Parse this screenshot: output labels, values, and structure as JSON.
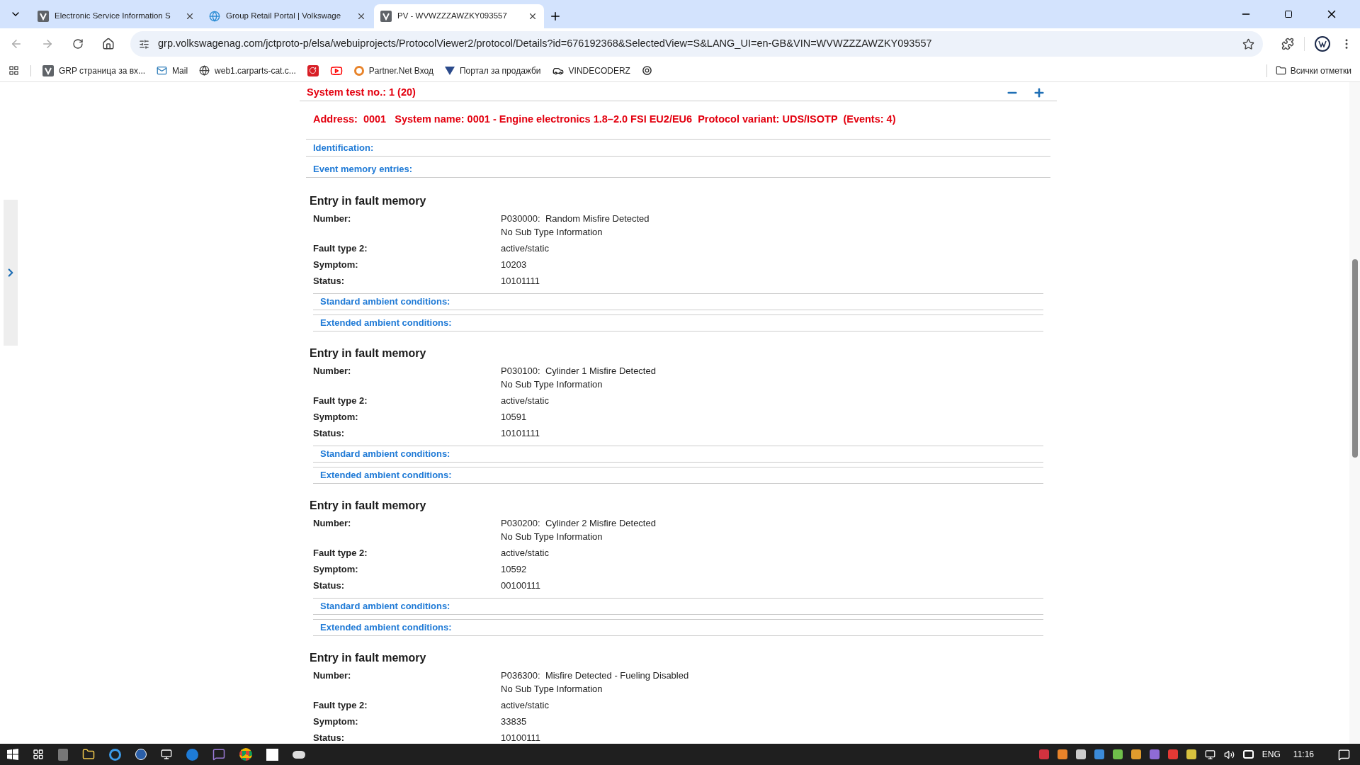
{
  "tabs": [
    {
      "title": "Electronic Service Information S",
      "selected": false
    },
    {
      "title": "Group Retail Portal | Volkswage",
      "selected": false
    },
    {
      "title": "PV - WVWZZZAWZKY093557",
      "selected": true
    }
  ],
  "address_bar": {
    "url": "grp.volkswagenag.com/jctproto-p/elsa/webuiprojects/ProtocolViewer2/protocol/Details?id=676192368&SelectedView=S&LANG_UI=en-GB&VIN=WVWZZZAWZKY093557"
  },
  "bookmarks": [
    {
      "label": "GRP страница за вх..."
    },
    {
      "label": "Mail"
    },
    {
      "label": "web1.carparts-cat.c..."
    },
    {
      "label": "Partner.Net Вход"
    },
    {
      "label": "Портал за продажби"
    },
    {
      "label": "VINDECODERZ"
    }
  ],
  "all_bookmarks": "Всички отметки",
  "system_test": {
    "title": "System test no.: 1 (20)",
    "summary": "Address:  0001   System name: 0001 - Engine electronics 1.8–2.0 FSI EU2/EU6  Protocol variant: UDS/ISOTP  (Events: 4)",
    "sections": [
      "Identification:",
      "Event memory entries:"
    ]
  },
  "entries": [
    {
      "heading": "Entry in fault memory",
      "fields": [
        {
          "label": "Number:",
          "lines": [
            "P030000:  Random Misfire Detected",
            "No Sub Type Information"
          ]
        },
        {
          "label": "Fault type 2:",
          "lines": [
            "active/static"
          ]
        },
        {
          "label": "Symptom:",
          "lines": [
            "10203"
          ]
        },
        {
          "label": "Status:",
          "lines": [
            "10101111"
          ]
        }
      ],
      "links": [
        "Standard ambient conditions:",
        "Extended ambient conditions:"
      ]
    },
    {
      "heading": "Entry in fault memory",
      "fields": [
        {
          "label": "Number:",
          "lines": [
            "P030100:  Cylinder 1 Misfire Detected",
            "No Sub Type Information"
          ]
        },
        {
          "label": "Fault type 2:",
          "lines": [
            "active/static"
          ]
        },
        {
          "label": "Symptom:",
          "lines": [
            "10591"
          ]
        },
        {
          "label": "Status:",
          "lines": [
            "10101111"
          ]
        }
      ],
      "links": [
        "Standard ambient conditions:",
        "Extended ambient conditions:"
      ]
    },
    {
      "heading": "Entry in fault memory",
      "fields": [
        {
          "label": "Number:",
          "lines": [
            "P030200:  Cylinder 2 Misfire Detected",
            "No Sub Type Information"
          ]
        },
        {
          "label": "Fault type 2:",
          "lines": [
            "active/static"
          ]
        },
        {
          "label": "Symptom:",
          "lines": [
            "10592"
          ]
        },
        {
          "label": "Status:",
          "lines": [
            "00100111"
          ]
        }
      ],
      "links": [
        "Standard ambient conditions:",
        "Extended ambient conditions:"
      ]
    },
    {
      "heading": "Entry in fault memory",
      "fields": [
        {
          "label": "Number:",
          "lines": [
            "P036300:  Misfire Detected - Fueling Disabled",
            "No Sub Type Information"
          ]
        },
        {
          "label": "Fault type 2:",
          "lines": [
            "active/static"
          ]
        },
        {
          "label": "Symptom:",
          "lines": [
            "33835"
          ]
        },
        {
          "label": "Status:",
          "lines": [
            "10100111"
          ]
        }
      ]
    }
  ],
  "taskbar": {
    "language": "ENG",
    "time": "11:16"
  }
}
